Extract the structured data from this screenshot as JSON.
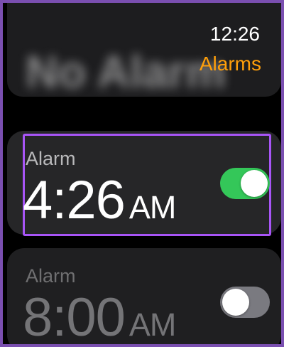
{
  "status_bar": {
    "time": "12:26"
  },
  "header": {
    "title": "Alarms",
    "blurred_text": "No Alarm"
  },
  "alarms": [
    {
      "label": "Alarm",
      "time": "4:26",
      "ampm": "AM",
      "enabled": true
    },
    {
      "label": "Alarm",
      "time": "8:00",
      "ampm": "AM",
      "enabled": false
    }
  ],
  "colors": {
    "accent": "#ff9f0a",
    "toggle_on": "#34c759",
    "toggle_off": "#7a7a80",
    "focus": "#a855f7"
  }
}
